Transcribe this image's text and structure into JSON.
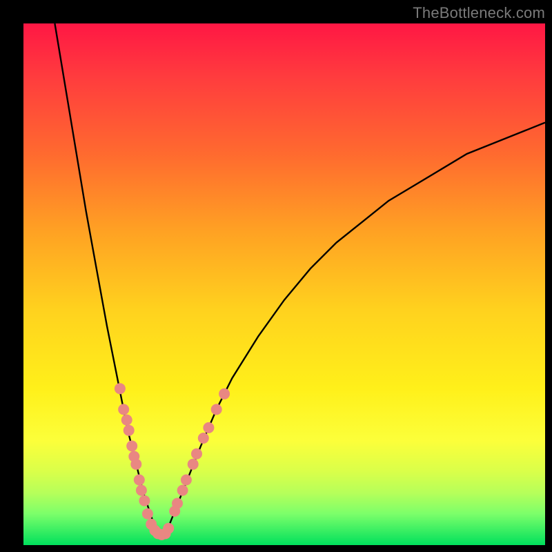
{
  "watermark": "TheBottleneck.com",
  "colors": {
    "curve_stroke": "#000000",
    "marker_fill": "#e98782",
    "marker_stroke": "#d97a75"
  },
  "chart_data": {
    "type": "line",
    "title": "",
    "xlabel": "",
    "ylabel": "",
    "xlim": [
      0,
      100
    ],
    "ylim": [
      0,
      100
    ],
    "grid": false,
    "series": [
      {
        "name": "left-curve",
        "x": [
          6,
          8,
          10,
          12,
          14,
          16,
          18,
          19,
          20,
          21,
          22,
          23,
          24,
          25,
          26
        ],
        "y": [
          100,
          88,
          76,
          64,
          53,
          42,
          32,
          27,
          22,
          18,
          14,
          10,
          7,
          4,
          2
        ]
      },
      {
        "name": "right-curve",
        "x": [
          27,
          28,
          30,
          32,
          34,
          37,
          40,
          45,
          50,
          55,
          60,
          65,
          70,
          75,
          80,
          85,
          90,
          95,
          100
        ],
        "y": [
          2,
          4,
          9,
          14,
          19,
          26,
          32,
          40,
          47,
          53,
          58,
          62,
          66,
          69,
          72,
          75,
          77,
          79,
          81
        ]
      }
    ],
    "markers": [
      {
        "x": 18.5,
        "y": 30
      },
      {
        "x": 19.2,
        "y": 26
      },
      {
        "x": 19.8,
        "y": 24
      },
      {
        "x": 20.2,
        "y": 22
      },
      {
        "x": 20.8,
        "y": 19
      },
      {
        "x": 21.2,
        "y": 17
      },
      {
        "x": 21.6,
        "y": 15.5
      },
      {
        "x": 22.2,
        "y": 12.5
      },
      {
        "x": 22.6,
        "y": 10.5
      },
      {
        "x": 23.2,
        "y": 8.5
      },
      {
        "x": 23.8,
        "y": 6
      },
      {
        "x": 24.5,
        "y": 4
      },
      {
        "x": 25.2,
        "y": 2.8
      },
      {
        "x": 25.8,
        "y": 2.2
      },
      {
        "x": 26.5,
        "y": 2.0
      },
      {
        "x": 27.2,
        "y": 2.2
      },
      {
        "x": 27.8,
        "y": 3.2
      },
      {
        "x": 29.0,
        "y": 6.5
      },
      {
        "x": 29.5,
        "y": 8.0
      },
      {
        "x": 30.5,
        "y": 10.5
      },
      {
        "x": 31.2,
        "y": 12.5
      },
      {
        "x": 32.5,
        "y": 15.5
      },
      {
        "x": 33.2,
        "y": 17.5
      },
      {
        "x": 34.5,
        "y": 20.5
      },
      {
        "x": 35.5,
        "y": 22.5
      },
      {
        "x": 37.0,
        "y": 26.0
      },
      {
        "x": 38.5,
        "y": 29.0
      }
    ]
  }
}
